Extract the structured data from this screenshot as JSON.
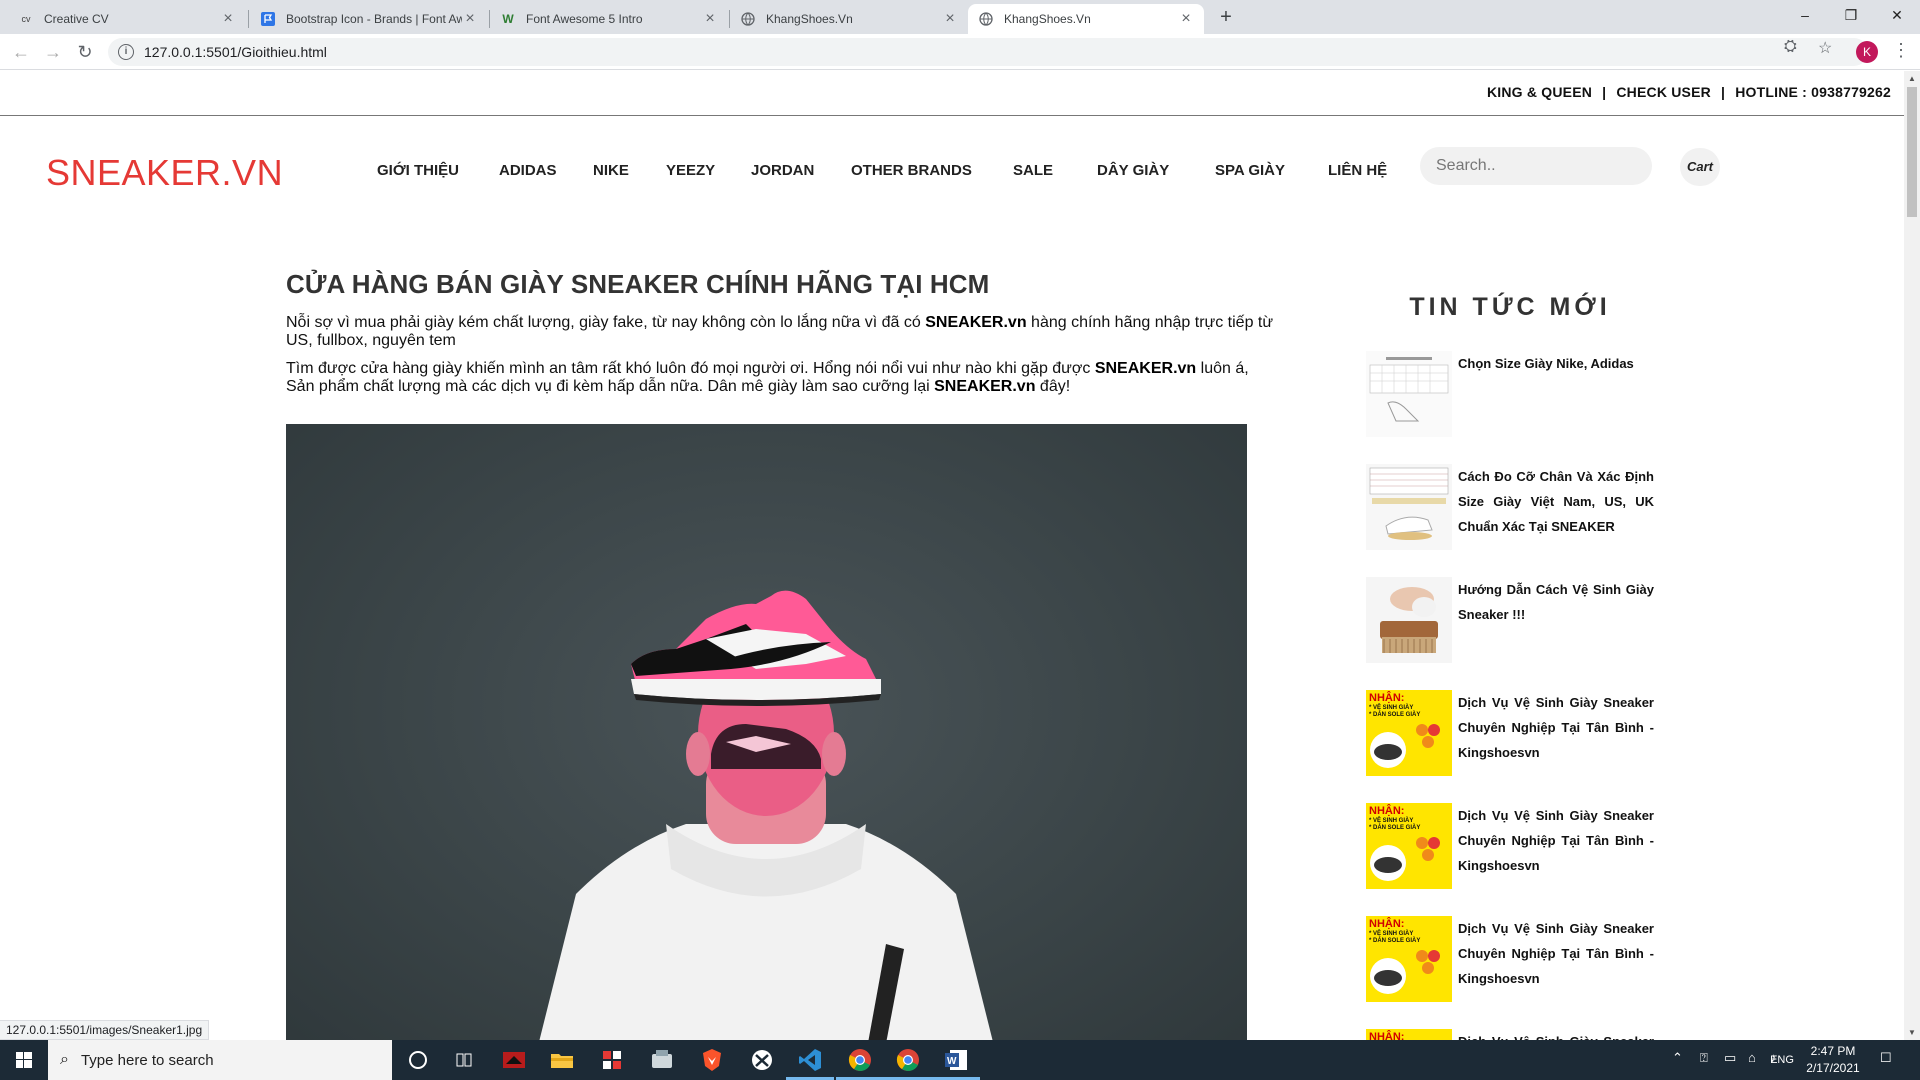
{
  "browser": {
    "tabs": [
      {
        "title": "Creative CV",
        "icon": "cv"
      },
      {
        "title": "Bootstrap Icon - Brands | Font Aw",
        "icon": "bootstrap-flag-icon"
      },
      {
        "title": "Font Awesome 5 Intro",
        "icon": "w3-icon"
      },
      {
        "title": "KhangShoes.Vn",
        "icon": "globe-icon"
      },
      {
        "title": "KhangShoes.Vn",
        "icon": "globe-icon"
      }
    ],
    "active_tab": 4,
    "url": "127.0.0.1:5501/Gioithieu.html",
    "profile_initial": "K",
    "status_url": "127.0.0.1:5501/images/Sneaker1.jpg"
  },
  "topbar": {
    "link1": "KING & QUEEN",
    "link2": "CHECK USER",
    "link3": "HOTLINE : 0938779262",
    "sep": "|"
  },
  "header": {
    "logo": "SNEAKER.VN",
    "nav": [
      "GIỚI THIỆU",
      "ADIDAS",
      "NIKE",
      "YEEZY",
      "JORDAN",
      "OTHER BRANDS",
      "SALE",
      "DÂY GIÀY",
      "SPA GIÀY",
      "LIÊN HỆ"
    ],
    "search_placeholder": "Search..",
    "cart_label": "Cart"
  },
  "article": {
    "title": "CỬA HÀNG BÁN GIÀY SNEAKER CHÍNH HÃNG TẠI HCM",
    "p1_before": "Nỗi sợ vì mua phải giày kém chất lượng, giày fake, từ nay không còn lo lắng nữa vì đã có ",
    "p1_brand": "SNEAKER.vn",
    "p1_after": " hàng chính hãng nhập trực tiếp từ US, fullbox, nguyên tem",
    "p2_before": "Tìm được cửa hàng giày khiến mình an tâm rất khó luôn đó mọi người ơi. Hổng nói nổi vui như nào khi gặp được ",
    "p2_brand1": "SNEAKER.vn",
    "p2_middle": " luôn á, Sản phẩm chất lượng mà các dịch vụ đi kèm hấp dẫn nữa. Dân mê giày làm sao cưỡng lại ",
    "p2_brand2": "SNEAKER.vn",
    "p2_after": " đây!"
  },
  "sidebar": {
    "heading": "TIN TỨC MỚI",
    "news": [
      {
        "title": "Chọn Size Giày Nike, Adidas",
        "thumb": "size-chart"
      },
      {
        "title": "Cách Đo Cỡ Chân Và Xác Định Size Giày Việt Nam, US, UK Chuẩn Xác Tại SNEAKER",
        "thumb": "size-chart-foot"
      },
      {
        "title": "Hướng Dẫn Cách Vệ Sinh Giày Sneaker !!!",
        "thumb": "brush"
      },
      {
        "title": "Dịch Vụ Vệ Sinh Giày Sneaker Chuyên Nghiệp Tại Tân Bình - Kingshoesvn",
        "thumb": "yellow-promo"
      },
      {
        "title": "Dịch Vụ Vệ Sinh Giày Sneaker Chuyên Nghiệp Tại Tân Bình - Kingshoesvn",
        "thumb": "yellow-promo"
      },
      {
        "title": "Dịch Vụ Vệ Sinh Giày Sneaker Chuyên Nghiệp Tại Tân Bình - Kingshoesvn",
        "thumb": "yellow-promo"
      },
      {
        "title": "Dịch Vụ Vệ Sinh Giày Sneaker Chuyên Nghiệp Tại Tân Bình - Kingshoesvn",
        "thumb": "yellow-promo"
      }
    ],
    "promo_text": "NHẬN:",
    "promo_line1": "* VỆ SINH GIÀY",
    "promo_line2": "* DÁN SOLE GIÀY"
  },
  "taskbar": {
    "search_placeholder": "Type here to search",
    "lang": "ENG",
    "time": "2:47 PM",
    "date": "2/17/2021"
  },
  "colors": {
    "logo": "#e53935",
    "promo_yellow": "#ffe500",
    "taskbar": "#1c2a36"
  }
}
